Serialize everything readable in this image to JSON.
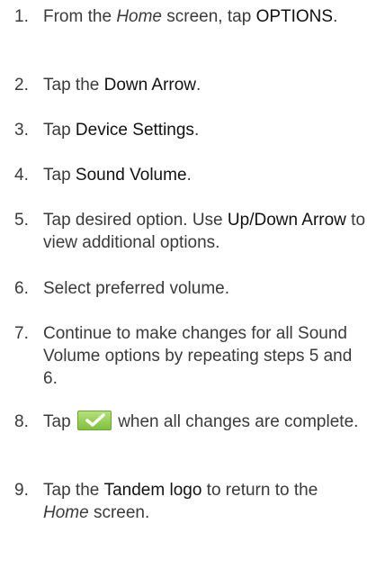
{
  "steps": [
    {
      "number": "1.",
      "parts": [
        {
          "t": "From the ",
          "s": "n"
        },
        {
          "t": "Home",
          "s": "i"
        },
        {
          "t": " screen, tap ",
          "s": "n"
        },
        {
          "t": "OPTIONS",
          "s": "b"
        },
        {
          "t": ".",
          "s": "n"
        }
      ]
    },
    {
      "number": "2.",
      "parts": [
        {
          "t": "Tap the ",
          "s": "n"
        },
        {
          "t": "Down Arrow",
          "s": "b"
        },
        {
          "t": ".",
          "s": "n"
        }
      ]
    },
    {
      "number": "3.",
      "parts": [
        {
          "t": "Tap ",
          "s": "n"
        },
        {
          "t": "Device Settings",
          "s": "b"
        },
        {
          "t": ".",
          "s": "n"
        }
      ]
    },
    {
      "number": "4.",
      "parts": [
        {
          "t": "Tap ",
          "s": "n"
        },
        {
          "t": "Sound Volume",
          "s": "b"
        },
        {
          "t": ".",
          "s": "n"
        }
      ]
    },
    {
      "number": "5.",
      "parts": [
        {
          "t": "Tap desired option. Use ",
          "s": "n"
        },
        {
          "t": "Up/Down Arrow",
          "s": "b"
        },
        {
          "t": " to view additional options.",
          "s": "n"
        }
      ]
    },
    {
      "number": "6.",
      "parts": [
        {
          "t": "Select preferred volume.",
          "s": "n"
        }
      ]
    },
    {
      "number": "7.",
      "parts": [
        {
          "t": "Continue to make changes for all Sound Volume options by repeating steps 5 and 6.",
          "s": "n"
        }
      ]
    },
    {
      "number": "8.",
      "parts": [
        {
          "t": "Tap ",
          "s": "n"
        },
        {
          "t": "",
          "s": "checkmark"
        },
        {
          "t": " when all changes are complete.",
          "s": "n"
        }
      ]
    },
    {
      "number": "9.",
      "parts": [
        {
          "t": "Tap the ",
          "s": "n"
        },
        {
          "t": "Tandem logo",
          "s": "b"
        },
        {
          "t": " to return to the ",
          "s": "n"
        },
        {
          "t": "Home",
          "s": "i"
        },
        {
          "t": " screen.",
          "s": "n"
        }
      ]
    }
  ],
  "icons": {
    "confirm_button": "checkmark-icon",
    "confirm_color": "#8cc63f"
  }
}
